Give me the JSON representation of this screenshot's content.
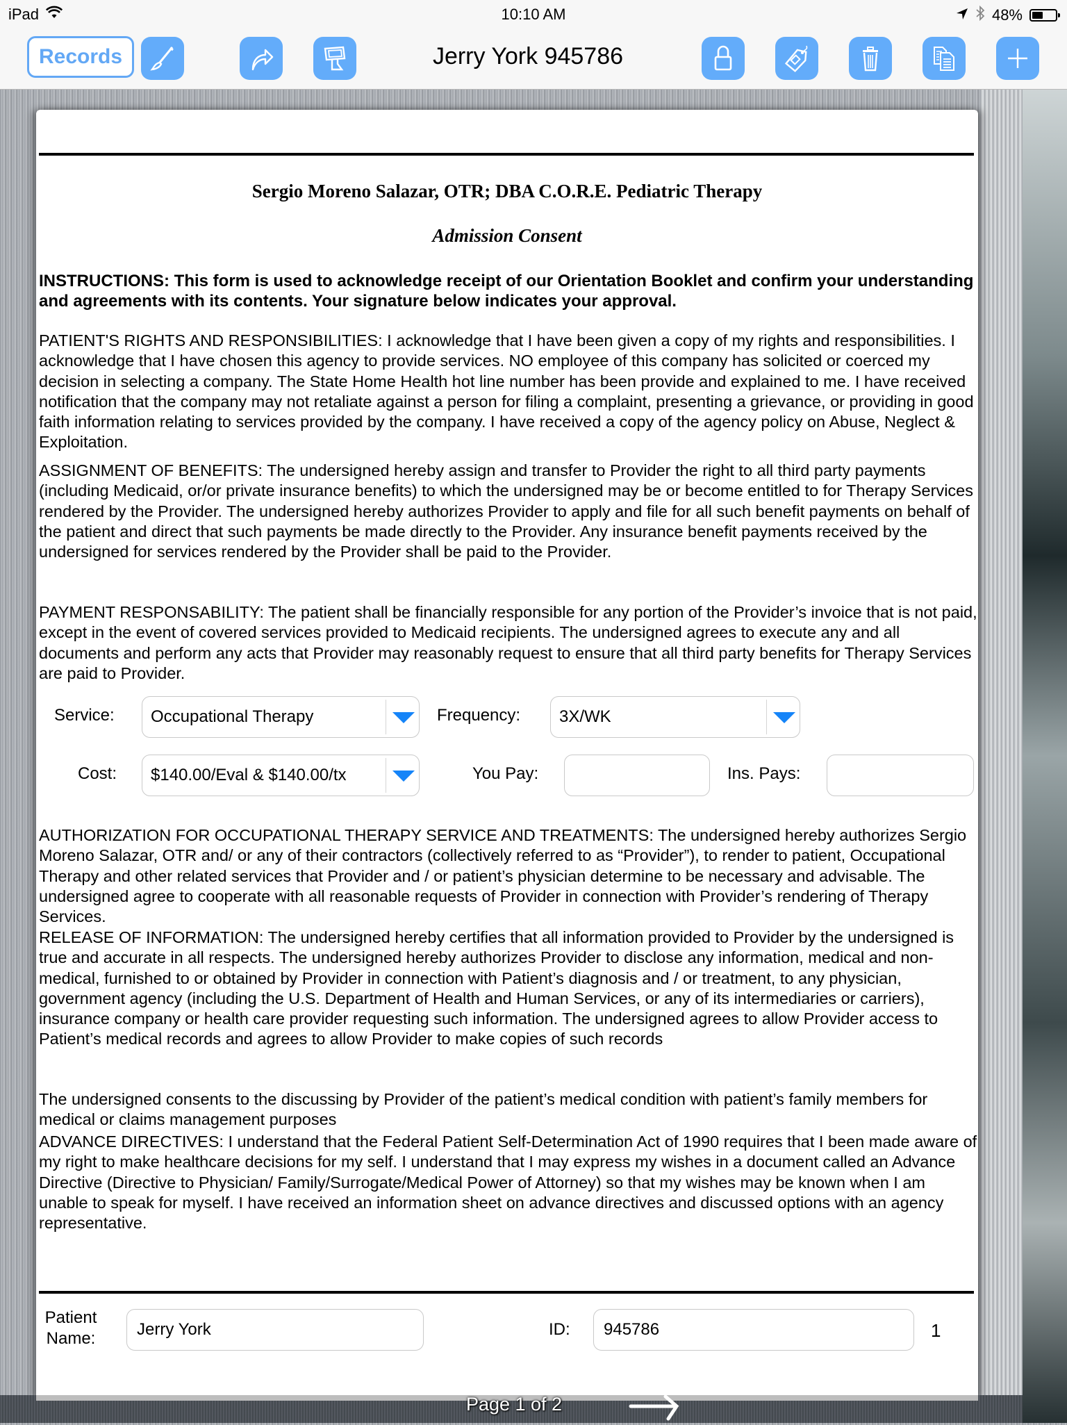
{
  "status_bar": {
    "device": "iPad",
    "time": "10:10 AM",
    "battery_percent": "48%",
    "battery_level": 0.48
  },
  "toolbar": {
    "records_label": "Records",
    "title": "Jerry York 945786",
    "left_icons": [
      "brush-icon",
      "share-icon",
      "kiosk-icon"
    ],
    "right_icons": [
      "lock-icon",
      "tag-icon",
      "trash-icon",
      "copy-icon",
      "plus-icon"
    ],
    "accent_color": "#63acfa"
  },
  "document": {
    "title": "Sergio Moreno Salazar, OTR; DBA C.O.R.E. Pediatric Therapy",
    "subtitle": "Admission Consent",
    "instructions": "INSTRUCTIONS: This form is used to acknowledge receipt of our Orientation Booklet and confirm your understanding and agreements with its contents. Your signature below indicates your approval.",
    "patient_rights": "PATIENT'S RIGHTS AND RESPONSIBILITIES: I acknowledge that I have been given a copy of my rights and responsibilities. I acknowledge that I have chosen this agency to provide services. NO employee of this company has solicited or coerced my decision in selecting a company. The State Home Health hot line number has been provide and explained to me. I have received notification that the company may not retaliate against a person for filing a complaint, presenting a grievance, or providing in good faith information relating to services provided by the company. I have received a copy of the agency policy on Abuse, Neglect & Exploitation.",
    "assignment_of_benefits": "ASSIGNMENT OF BENEFITS: The undersigned hereby assign and transfer to Provider the right to all third party payments (including Medicaid, or/or private insurance benefits) to which the undersigned may be or become entitled to for Therapy Services rendered by the Provider. The undersigned hereby authorizes Provider to apply and file for all such benefit payments on behalf of the patient and direct that such payments be made directly to the Provider. Any insurance benefit payments received by the undersigned for services rendered by the Provider shall be paid to the Provider.",
    "payment_responsibility": "PAYMENT RESPONSABILITY: The patient shall be financially responsible for any portion of the Provider’s invoice that is not paid, except in the event of covered services provided to Medicaid recipients. The undersigned agrees to execute any and all documents and perform any acts that Provider may reasonably request to ensure that all third party benefits for Therapy Services are paid to Provider.",
    "authorization": "AUTHORIZATION FOR OCCUPATIONAL THERAPY SERVICE AND TREATMENTS: The undersigned hereby authorizes Sergio Moreno Salazar, OTR and/ or any of their contractors (collectively referred to as “Provider”), to render to patient, Occupational Therapy and other related services that Provider and / or patient’s physician determine to be necessary and advisable. The undersigned agree to cooperate with all reasonable requests of Provider in connection with Provider’s rendering of Therapy Services.",
    "release_of_information": "RELEASE OF INFORMATION: The undersigned hereby certifies that all information provided to Provider by the undersigned is true and accurate in all respects. The undersigned hereby authorizes Provider to disclose any information, medical and non-medical, furnished to or obtained by Provider in connection with Patient’s diagnosis and / or treatment, to any physician, government agency (including the U.S. Department of Health and Human Services, or any of its intermediaries or carriers), insurance company or health care provider requesting such information. The undersigned agrees to allow Provider access to Patient’s medical records and agrees to allow Provider to make copies of such records",
    "consent_discussion": "The undersigned consents to the discussing by Provider of the patient’s medical condition with patient’s family members for medical or claims management purposes",
    "advance_directives": "ADVANCE DIRECTIVES: I understand that the Federal Patient Self-Determination Act of 1990 requires that I been made aware of my right to make healthcare decisions for my self. I understand that I may express my wishes in a document called an Advance Directive (Directive to Physician/ Family/Surrogate/Medical Power of Attorney) so that my wishes may be known when I am unable to speak for myself. I have received an information sheet on advance directives and discussed options with an agency representative."
  },
  "form": {
    "service": {
      "label": "Service:",
      "value": "Occupational Therapy"
    },
    "frequency": {
      "label": "Frequency:",
      "value": "3X/WK"
    },
    "cost": {
      "label": "Cost:",
      "value": "$140.00/Eval & $140.00/tx"
    },
    "you_pay": {
      "label": "You Pay:",
      "value": ""
    },
    "ins_pays": {
      "label": "Ins. Pays:",
      "value": ""
    },
    "caret_color": "#1584f8"
  },
  "footer": {
    "patient_name_label": "Patient Name:",
    "patient_name_value": "Jerry York",
    "id_label": "ID:",
    "id_value": "945786",
    "page_number": "1"
  },
  "pagination": {
    "indicator": "Page 1 of 2",
    "next_icon": "right-arrow-icon"
  }
}
